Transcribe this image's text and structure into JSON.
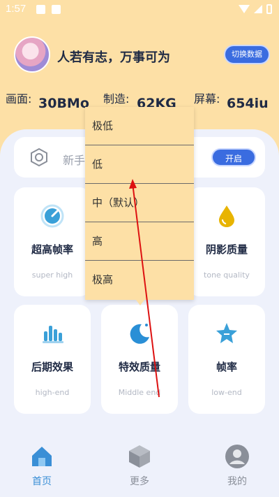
{
  "status_bar": {
    "time": "1:57"
  },
  "header": {
    "slogan": "人若有志，万事可为",
    "switch_button": "切换数据"
  },
  "stats": [
    {
      "label": "画面:",
      "value": "30BMo"
    },
    {
      "label": "制造:",
      "value": "62KG"
    },
    {
      "label": "屏幕:",
      "value": "654iu"
    }
  ],
  "search": {
    "text": "新手",
    "button": "开启"
  },
  "cards": [
    {
      "title": "超高帧率",
      "sub": "super high",
      "icon": "speed-gauge-icon",
      "color": "#3aa0d8"
    },
    {
      "title": "",
      "sub": "",
      "icon": "",
      "color": ""
    },
    {
      "title": "阴影质量",
      "sub": "tone quality",
      "icon": "drop-icon",
      "color": "#e8b400"
    },
    {
      "title": "后期效果",
      "sub": "high-end",
      "icon": "bar-chart-icon",
      "color": "#3aa0d8"
    },
    {
      "title": "特效质量",
      "sub": "Middle end",
      "icon": "moon-icon",
      "color": "#2a8fd6"
    },
    {
      "title": "帧率",
      "sub": "low-end",
      "icon": "star-icon",
      "color": "#3aa0d8"
    }
  ],
  "dropdown": {
    "options": [
      "极低",
      "低",
      "中（默认）",
      "高",
      "极高"
    ]
  },
  "bottom_nav": [
    {
      "label": "首页",
      "icon": "home-icon",
      "active": true,
      "color": "#3a8fd6"
    },
    {
      "label": "更多",
      "icon": "cube-icon",
      "active": false,
      "color": "#8a8f99"
    },
    {
      "label": "我的",
      "icon": "user-icon",
      "active": false,
      "color": "#8a8f99"
    }
  ]
}
